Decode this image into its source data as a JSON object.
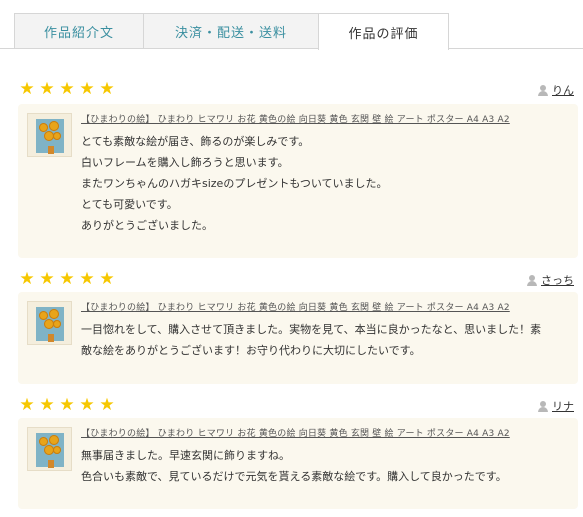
{
  "tabs": [
    {
      "label": "作品紹介文",
      "active": false
    },
    {
      "label": "決済・配送・送料",
      "active": false
    },
    {
      "label": "作品の評価",
      "active": true
    }
  ],
  "colors": {
    "star": "#f6c700",
    "tab_text": "#3a8fa0",
    "card_bg": "#fbf8ee"
  },
  "reviews": [
    {
      "rating": 5,
      "reviewer": "りん",
      "product": "【ひまわりの絵】 ひまわり ヒマワリ お花 黄色の絵 向日葵 黄色 玄関 壁 絵 アート ポスター A4 A3 A2",
      "lines": [
        "とても素敵な絵が届き、飾るのが楽しみです。",
        "白いフレームを購入し飾ろうと思います。",
        "またワンちゃんのハガキsizeのプレゼントもついていました。",
        "とても可愛いです。",
        "ありがとうございました。"
      ]
    },
    {
      "rating": 5,
      "reviewer": "さっち",
      "product": "【ひまわりの絵】 ひまわり ヒマワリ お花 黄色の絵 向日葵 黄色 玄関 壁 絵 アート ポスター A4 A3 A2",
      "lines": [
        "一目惚れをして、購入させて頂きました。実物を見て、本当に良かったなと、思いました！素",
        "敵な絵をありがとうございます！お守り代わりに大切にしたいです。"
      ]
    },
    {
      "rating": 5,
      "reviewer": "リナ",
      "product": "【ひまわりの絵】 ひまわり ヒマワリ お花 黄色の絵 向日葵 黄色 玄関 壁 絵 アート ポスター A4 A3 A2",
      "lines": [
        "無事届きました。早速玄関に飾りますね。",
        "色合いも素敵で、見ているだけで元気を貰える素敵な絵です。購入して良かったです。"
      ]
    }
  ]
}
